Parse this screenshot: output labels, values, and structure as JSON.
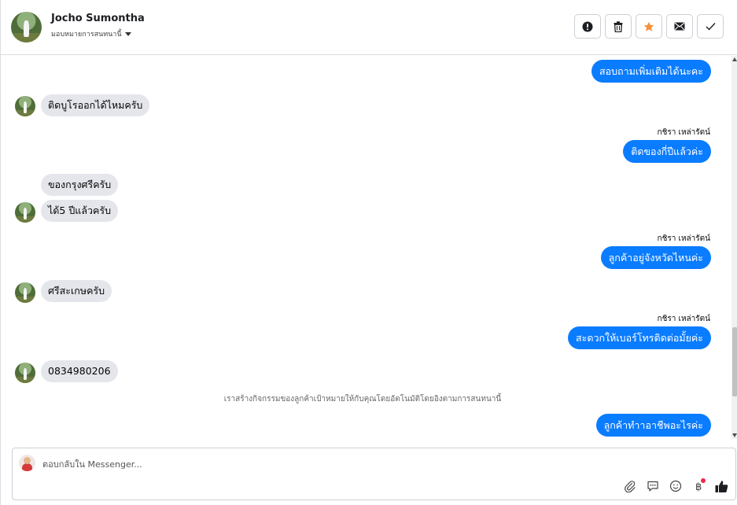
{
  "header": {
    "user_name": "Jocho Sumontha",
    "assign_label": "มอบหมายการสนทนานี้",
    "actions": [
      {
        "name": "report-button",
        "icon": "exclamation-icon"
      },
      {
        "name": "delete-button",
        "icon": "trash-icon"
      },
      {
        "name": "star-button",
        "icon": "star-icon"
      },
      {
        "name": "mark-unread-button",
        "icon": "envelope-icon"
      },
      {
        "name": "mark-done-button",
        "icon": "check-icon"
      }
    ]
  },
  "colors": {
    "outgoing_bubble": "#0a7cff",
    "incoming_bubble": "#e4e6eb",
    "star": "#f7923a",
    "notification_dot": "#f02849"
  },
  "thread": {
    "messages": [
      {
        "dir": "out",
        "text": "สอบถามเพิ่มเติมได้นะคะ"
      },
      {
        "dir": "in",
        "text": "ติดบูโรออกได้ไหมครับ"
      },
      {
        "dir": "out",
        "sender": "กชิรา เหล่ารัตน์",
        "text": "ติดของกี่ปีแล้วค่ะ"
      },
      {
        "dir": "in",
        "text": "ของกรุงศรีครับ"
      },
      {
        "dir": "in",
        "text": "ได้5 ปีแล้วครับ"
      },
      {
        "dir": "out",
        "sender": "กชิรา เหล่ารัตน์",
        "text": "ลูกค้าอยู่จังหวัดไหนค่ะ"
      },
      {
        "dir": "in",
        "text": "ศรีสะเกษครับ"
      },
      {
        "dir": "out",
        "sender": "กชิรา เหล่ารัตน์",
        "text": "สะดวกให้เบอร์โทรติดต่อมั้ยค่ะ"
      },
      {
        "dir": "in",
        "text": "0834980206"
      },
      {
        "dir": "system",
        "text": "เราสร้างกิจกรรมของลูกค้าเป้าหมายให้กับคุณโดยอัตโนมัติโดยอิงตามการสนทนานี้"
      },
      {
        "dir": "out",
        "text": "ลูกค้าทำาอาชีพอะไรค่ะ"
      }
    ]
  },
  "composer": {
    "placeholder": "ตอบกลับใน Messenger...",
    "tools": [
      "paperclip-icon",
      "saved-replies-icon",
      "emoji-icon",
      "payment-icon",
      "thumbs-up-icon"
    ]
  }
}
